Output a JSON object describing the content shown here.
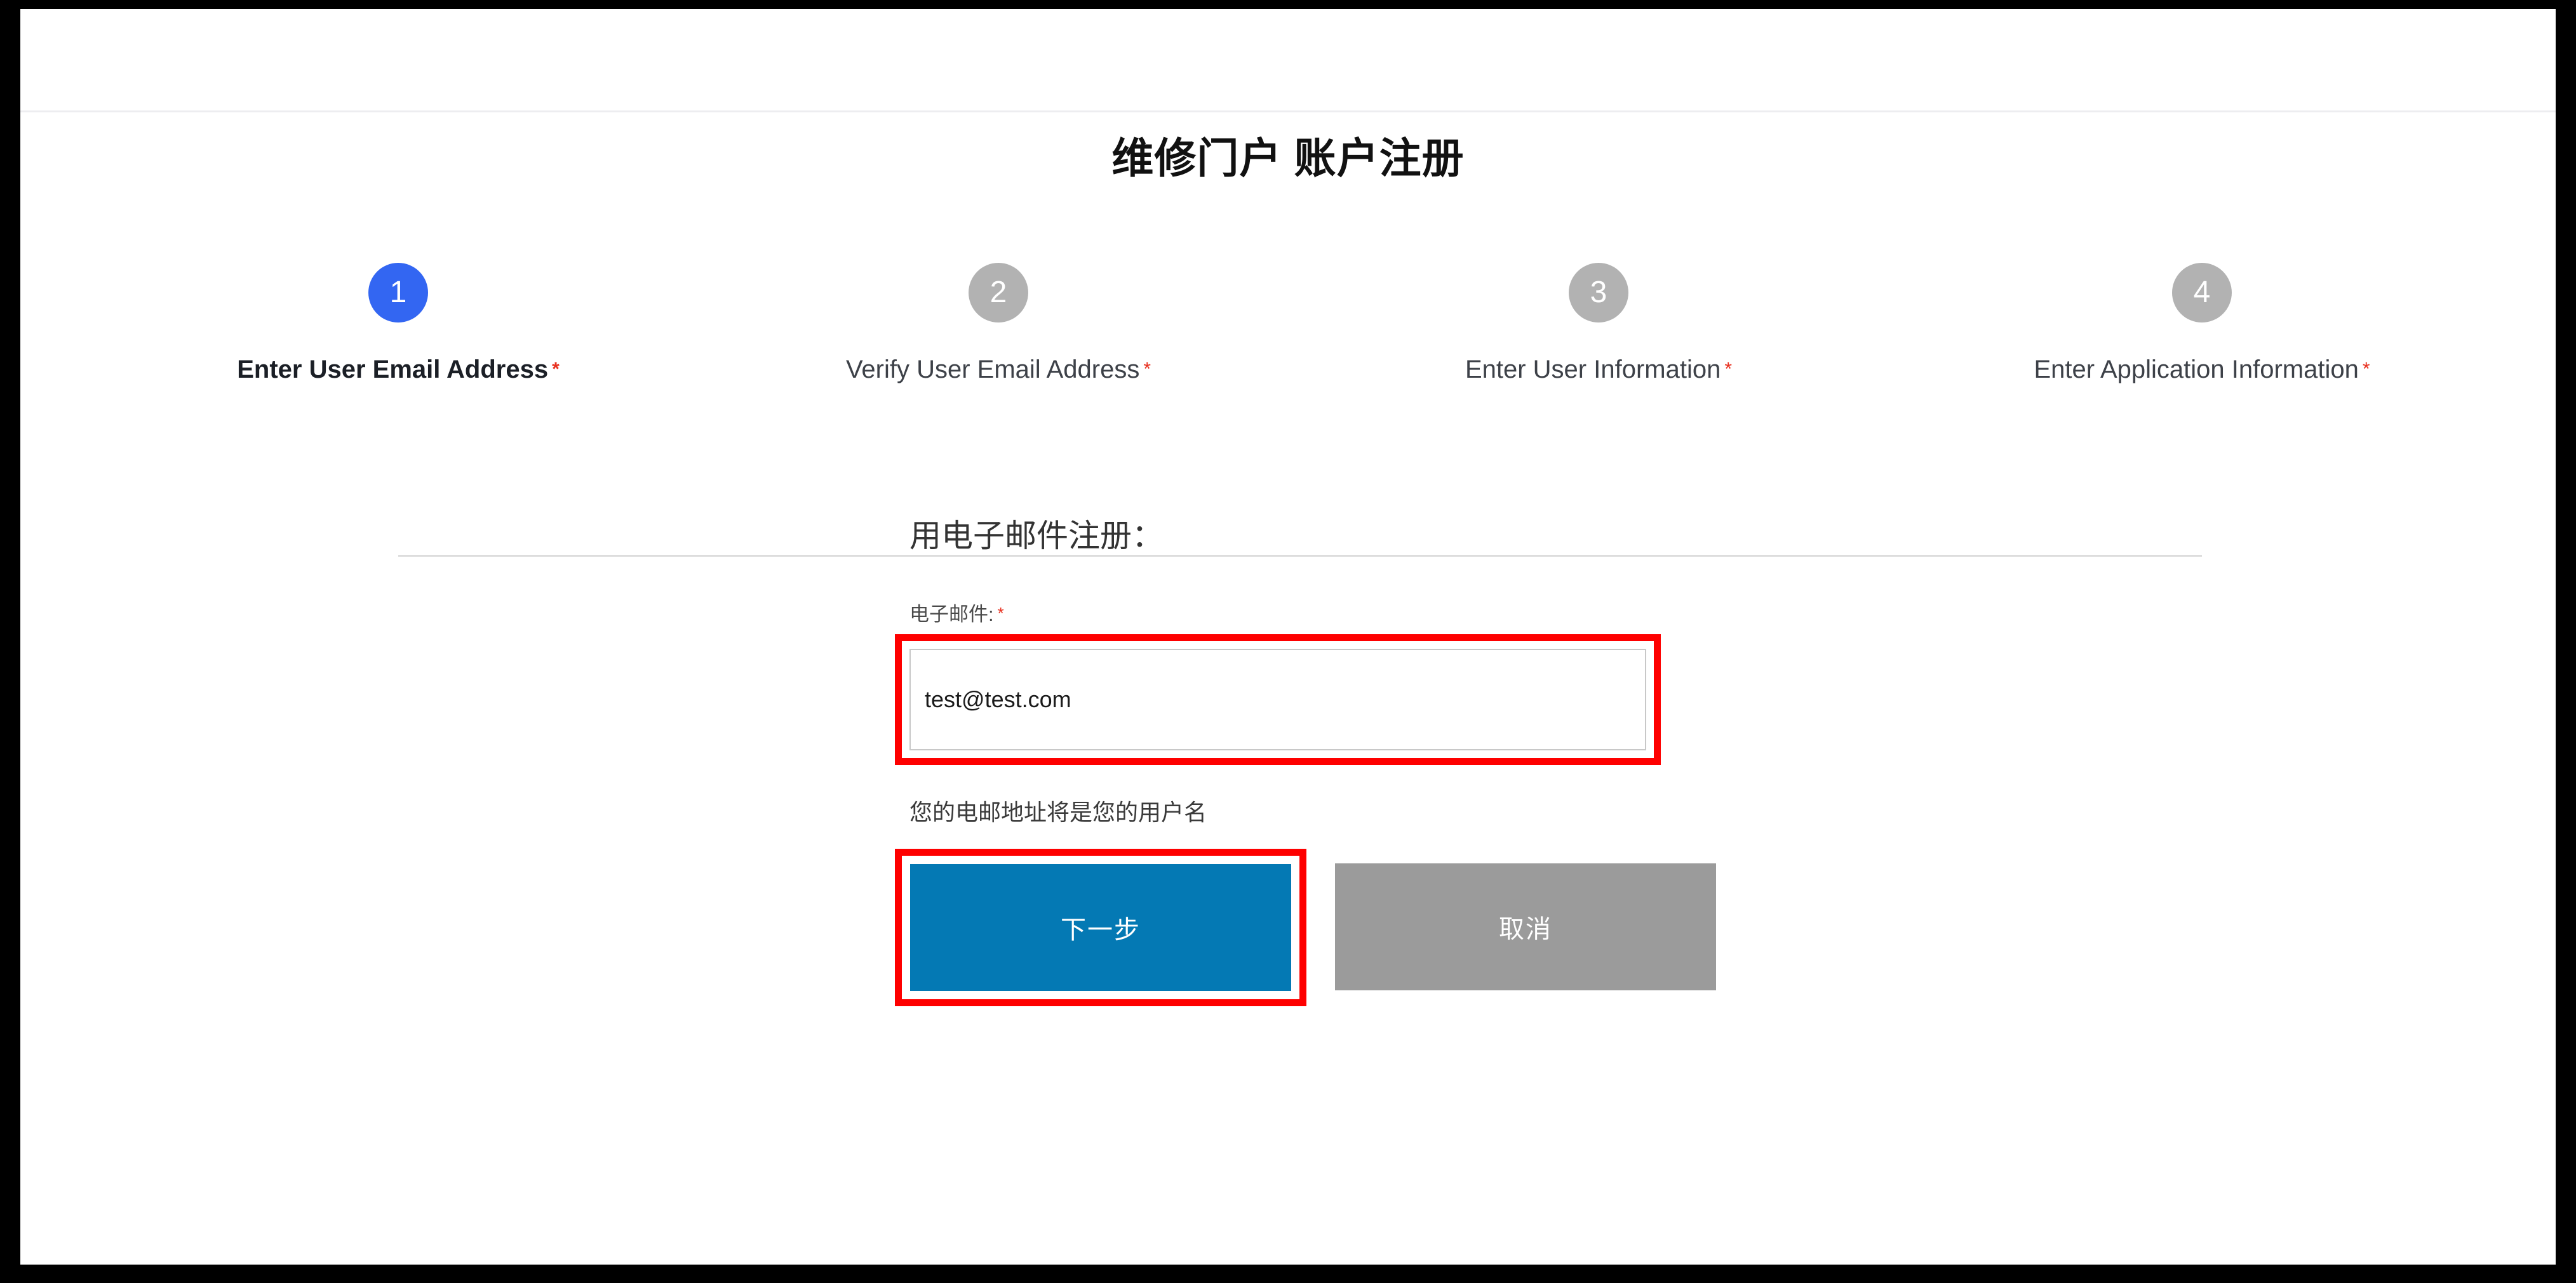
{
  "page": {
    "title": "维修门户 账户注册"
  },
  "stepper": {
    "steps": [
      {
        "number": "1",
        "label": "Enter User Email Address",
        "required_mark": "*",
        "state": "active"
      },
      {
        "number": "2",
        "label": "Verify User Email Address",
        "required_mark": "*",
        "state": "inactive"
      },
      {
        "number": "3",
        "label": "Enter User Information",
        "required_mark": "*",
        "state": "inactive"
      },
      {
        "number": "4",
        "label": "Enter Application Information",
        "required_mark": "*",
        "state": "inactive"
      }
    ],
    "active_color": "#3366f2",
    "inactive_color": "#b2b2b2",
    "track_color": "#dddddd"
  },
  "form": {
    "heading": "用电子邮件注册：",
    "email_label": "电子邮件:",
    "email_required_mark": "*",
    "email_value": "test@test.com",
    "email_placeholder": "",
    "helper_text": "您的电邮地址将是您的用户名",
    "next_button": "下一步",
    "cancel_button": "取消",
    "next_button_color": "#0479b4",
    "cancel_button_color": "#9b9b9b",
    "required_star_color": "#e8301f",
    "annotation_color": "#fe0000"
  }
}
